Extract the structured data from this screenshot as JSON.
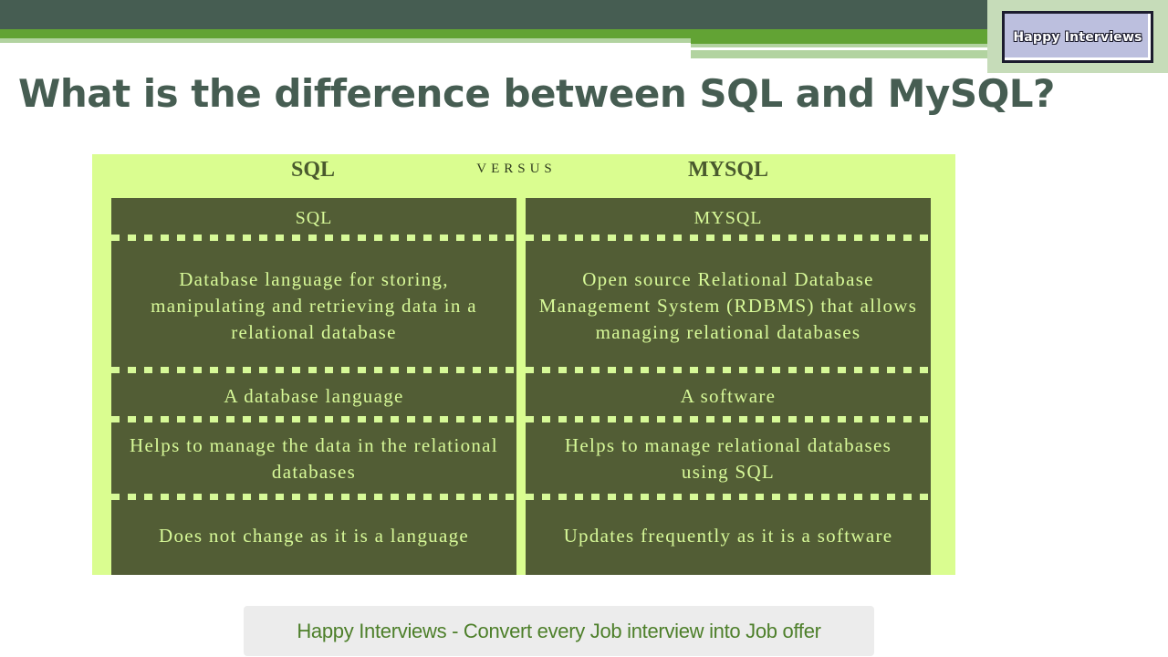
{
  "logo": {
    "text": "Happy Interviews"
  },
  "slide": {
    "title": "What is the difference between SQL and MySQL?"
  },
  "comparison": {
    "left_title": "SQL",
    "versus_label": "VERSUS",
    "right_title": "MYSQL",
    "left_column": [
      "SQL",
      "Database language for storing, manipulating and retrieving data in a relational database",
      "A database language",
      "Helps to manage the data in the relational databases",
      "Does not change as it is a language"
    ],
    "right_column": [
      "MYSQL",
      "Open source Relational Database Management System (RDBMS) that allows managing relational databases",
      "A software",
      "Helps to manage relational databases using SQL",
      "Updates frequently as it is a software"
    ]
  },
  "footer": {
    "text": "Happy Interviews - Convert every Job interview into Job offer"
  },
  "colors": {
    "header_dark": "#465d52",
    "header_green": "#62a334",
    "infographic_bg": "#dafd90",
    "cell_bg": "#525d35",
    "cell_text": "#d7f998",
    "footer_text": "#4d7f2a"
  }
}
